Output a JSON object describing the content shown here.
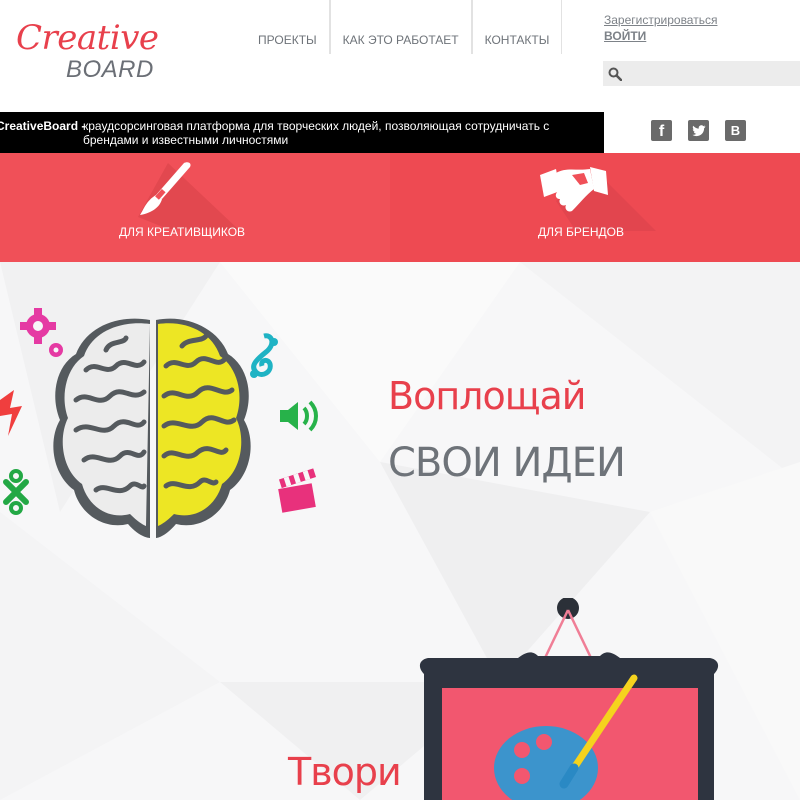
{
  "logo": {
    "creative": "Creative",
    "board": "BOARD"
  },
  "nav": {
    "items": [
      {
        "label": "ПРОЕКТЫ"
      },
      {
        "label": "КАК ЭТО РАБОТАЕТ"
      },
      {
        "label": "КОНТАКТЫ"
      }
    ]
  },
  "auth": {
    "register": "Зарегистрироваться",
    "login": "ВОЙТИ"
  },
  "search": {
    "icon": "search-icon",
    "placeholder": ""
  },
  "tagline": {
    "brand": "CreativeBoard -",
    "text": "краудсорсинговая платформа для творческих людей, позволяющая сотрудничать с брендами и известными личностями"
  },
  "social": {
    "facebook": "f",
    "twitter": "twitter-icon",
    "vk": "В"
  },
  "banner": {
    "creatives_label": "ДЛЯ КРЕАТИВЩИКОВ",
    "creatives_icon": "paintbrush-icon",
    "brands_label": "ДЛЯ БРЕНДОВ",
    "brands_icon": "handshake-icon"
  },
  "hero": {
    "headline_1": "Воплощай",
    "headline_2": "СВОИ ИДЕИ",
    "headline_3": "Твори",
    "illustrations": [
      "brain-icon",
      "gear-icon",
      "music-icon",
      "speaker-icon",
      "clapperboard-icon",
      "lightning-icon",
      "palette-painting-icon"
    ]
  },
  "colors": {
    "accent": "#f05058",
    "brand_red": "#e8404c",
    "text_gray": "#6e7379",
    "brain_yellow": "#ede624"
  }
}
